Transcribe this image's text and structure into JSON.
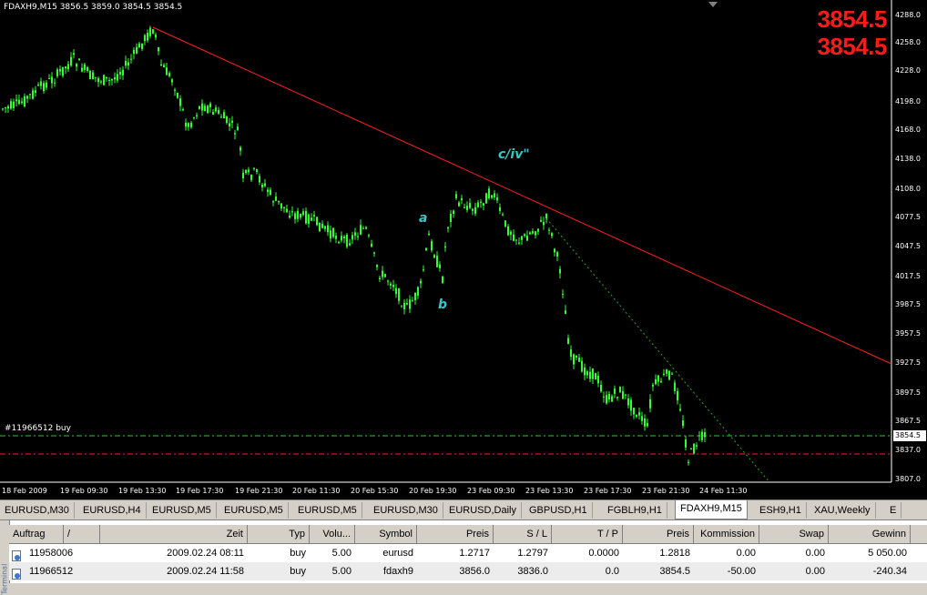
{
  "chart": {
    "symbol_info": "FDAXH9,M15  3856.5 3859.0 3854.5 3854.5",
    "bid_price": "3854.5",
    "ask_price": "3854.5",
    "current_price_tag": "3854.5",
    "order_label": "#11966512 buy",
    "wave_labels": {
      "a": "a",
      "b": "b",
      "c": "c/iv\""
    },
    "price_axis": [
      "4288.0",
      "4258.0",
      "4228.0",
      "4198.0",
      "4168.0",
      "4138.0",
      "4108.0",
      "4077.5",
      "4047.5",
      "4017.5",
      "3987.5",
      "3957.5",
      "3927.5",
      "3897.5",
      "3867.5",
      "3837.0",
      "3807.0"
    ],
    "time_axis": [
      "18 Feb 2009",
      "19 Feb 09:30",
      "19 Feb 13:30",
      "19 Feb 17:30",
      "19 Feb 21:30",
      "20 Feb 11:30",
      "20 Feb 15:30",
      "20 Feb 19:30",
      "23 Feb 09:30",
      "23 Feb 13:30",
      "23 Feb 17:30",
      "23 Feb 21:30",
      "24 Feb 11:30"
    ],
    "colors": {
      "background": "#000000",
      "candles": "#33ff33",
      "trendline": "#ff2020",
      "order_line": "#22cc22",
      "stoploss_line": "#ff2020",
      "wave_text": "#39c6c6"
    }
  },
  "tabs": [
    {
      "label": "EURUSD,M30"
    },
    {
      "label": "EURUSD,H4"
    },
    {
      "label": "EURUSD,M5"
    },
    {
      "label": "EURUSD,M5"
    },
    {
      "label": "EURUSD,M5"
    },
    {
      "label": "EURUSD,M30"
    },
    {
      "label": "EURUSD,Daily"
    },
    {
      "label": "GBPUSD,H1"
    },
    {
      "label": "FGBLH9,H1"
    },
    {
      "label": "FDAXH9,M15",
      "active": true
    },
    {
      "label": "ESH9,H1"
    },
    {
      "label": "XAU,Weekly"
    },
    {
      "label": "E"
    }
  ],
  "terminal": {
    "side_label": "Terminal",
    "columns": [
      "Auftrag",
      "/",
      "Zeit",
      "Typ",
      "Volu...",
      "Symbol",
      "Preis",
      "S / L",
      "T / P",
      "Preis",
      "Kommission",
      "Swap",
      "Gewinn"
    ],
    "rows": [
      {
        "order": "11958006",
        "time": "2009.02.24 08:11",
        "type": "buy",
        "volume": "5.00",
        "symbol": "eurusd",
        "price": "1.2717",
        "sl": "1.2797",
        "tp": "0.0000",
        "current": "1.2818",
        "commission": "0.00",
        "swap": "0.00",
        "profit": "5 050.00"
      },
      {
        "order": "11966512",
        "time": "2009.02.24 11:58",
        "type": "buy",
        "volume": "5.00",
        "symbol": "fdaxh9",
        "price": "3856.0",
        "sl": "3836.0",
        "tp": "0.0",
        "current": "3854.5",
        "commission": "-50.00",
        "swap": "0.00",
        "profit": "-240.34"
      }
    ]
  }
}
